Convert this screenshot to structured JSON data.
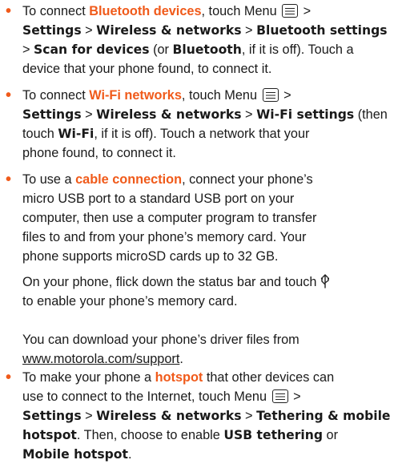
{
  "accent_color": "#f05a1a",
  "items": {
    "bluetooth": {
      "l1_pre": "To connect ",
      "l1_em": "Bluetooth devices",
      "l1_mid": ", touch Menu ",
      "l1_post": " >",
      "l2_b1": "Settings",
      "l2_sep1": " > ",
      "l2_b2": "Wireless & networks",
      "l2_sep2": " > ",
      "l2_b3": "Bluetooth settings",
      "l3_sep": "> ",
      "l3_b1": "Scan for devices",
      "l3_mid": " (or ",
      "l3_b2": "Bluetooth",
      "l3_post": ", if it is off). Touch a",
      "l4": "device that your phone found, to connect it."
    },
    "wifi": {
      "l1_pre": "To connect ",
      "l1_em": "Wi-Fi networks",
      "l1_mid": ", touch Menu ",
      "l1_post": " >",
      "l2_b1": "Settings",
      "l2_sep1": " > ",
      "l2_b2": "Wireless & networks",
      "l2_sep2": " > ",
      "l2_b3": "Wi-Fi settings",
      "l2_post": " (then",
      "l3_pre": "touch ",
      "l3_b1": "Wi-Fi",
      "l3_post": ", if it is off). Touch a network that your",
      "l4": "phone found, to connect it."
    },
    "cable": {
      "l1_pre": "To use a ",
      "l1_em": "cable connection",
      "l1_post": ", connect your phone’s",
      "l2": "micro USB port to a standard USB port on your",
      "l3": "computer, then use a computer program to transfer",
      "l4": "files to and from your phone’s memory card. Your",
      "l5": "phone supports microSD cards up to 32 GB.",
      "p2_l1": "On your phone, flick down the status bar and touch",
      "p2_l2": "to enable your phone’s memory card.",
      "p3_l1": "You can download your phone’s driver files from",
      "p3_link": "www.motorola.com/support",
      "p3_post": "."
    },
    "hotspot": {
      "l1_pre": "To make your phone a ",
      "l1_em": "hotspot",
      "l1_post": " that other devices can",
      "l2_pre": "use to connect to the Internet, touch Menu ",
      "l2_post": " >",
      "l3_b1": "Settings",
      "l3_sep1": " > ",
      "l3_b2": "Wireless & networks",
      "l3_sep2": " > ",
      "l3_b3": "Tethering & mobile",
      "l4_b1": "hotspot",
      "l4_mid": ". Then, choose to enable ",
      "l4_b2": "USB tethering",
      "l4_post": " or",
      "l5_b1": "Mobile hotspot",
      "l5_post": "."
    }
  }
}
